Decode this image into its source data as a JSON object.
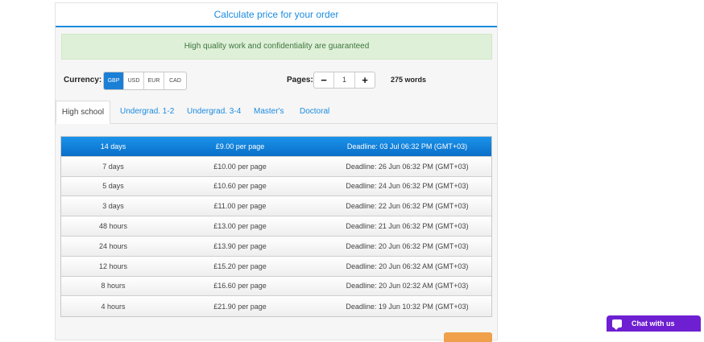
{
  "panel": {
    "title": "Calculate price for your order"
  },
  "notice": "High quality work and confidentiality are guaranteed",
  "currency": {
    "label": "Currency:",
    "options": [
      "GBP",
      "USD",
      "EUR",
      "CAD"
    ],
    "selected": "GBP"
  },
  "pages": {
    "label": "Pages:",
    "minus": "−",
    "value": "1",
    "plus": "+",
    "words": "275 words"
  },
  "tabs": [
    "High school",
    "Undergrad. 1-2",
    "Undergrad. 3-4",
    "Master's",
    "Doctoral"
  ],
  "active_tab": "High school",
  "price_rows": [
    {
      "term": "14 days",
      "price": "£9.00 per page",
      "deadline": "Deadline: 03 Jul 06:32 PM (GMT+03)",
      "selected": true
    },
    {
      "term": "7 days",
      "price": "£10.00 per page",
      "deadline": "Deadline: 26 Jun 06:32 PM (GMT+03)"
    },
    {
      "term": "5 days",
      "price": "£10.60 per page",
      "deadline": "Deadline: 24 Jun 06:32 PM (GMT+03)"
    },
    {
      "term": "3 days",
      "price": "£11.00 per page",
      "deadline": "Deadline: 22 Jun 06:32 PM (GMT+03)"
    },
    {
      "term": "48 hours",
      "price": "£13.00 per page",
      "deadline": "Deadline: 21 Jun 06:32 PM (GMT+03)"
    },
    {
      "term": "24 hours",
      "price": "£13.90 per page",
      "deadline": "Deadline: 20 Jun 06:32 PM (GMT+03)"
    },
    {
      "term": "12 hours",
      "price": "£15.20 per page",
      "deadline": "Deadline: 20 Jun 06:32 AM (GMT+03)"
    },
    {
      "term": "8 hours",
      "price": "£16.60 per page",
      "deadline": "Deadline: 20 Jun 02:32 AM (GMT+03)"
    },
    {
      "term": "4 hours",
      "price": "£21.90 per page",
      "deadline": "Deadline: 19 Jun 10:32 PM (GMT+03)"
    }
  ],
  "chat": {
    "label": "Chat with us",
    "icon": "chat-bubble-icon"
  },
  "colors": {
    "accent": "#1b8be0",
    "chat": "#6d1fd1",
    "notice_bg": "#dff0d8",
    "orange": "#f0a04b"
  }
}
